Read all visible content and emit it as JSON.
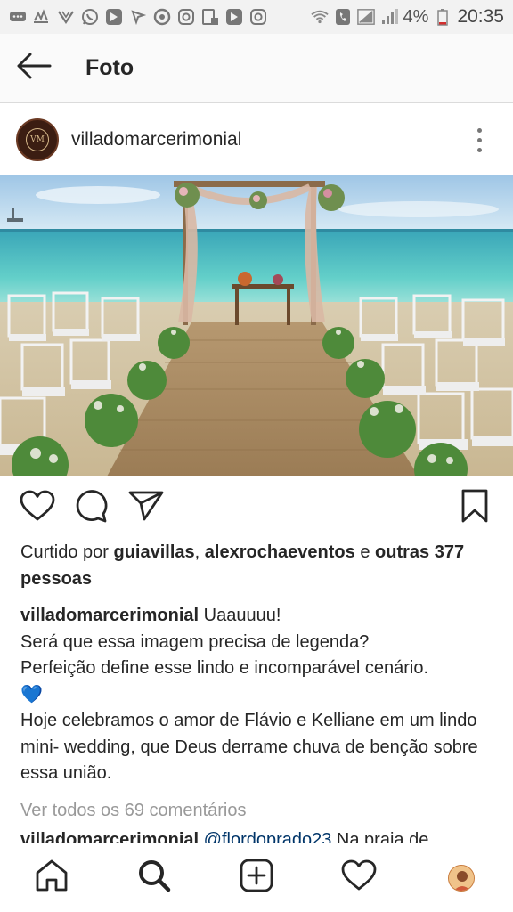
{
  "status_bar": {
    "battery": "4%",
    "time": "20:35",
    "icons": [
      "chat-icon",
      "sms-icon",
      "wifi-call-icon",
      "vpn-icon",
      "whatsapp-icon",
      "app-icon",
      "kite-icon",
      "chrome-icon",
      "instagram-icon",
      "upload-icon",
      "app-icon-2",
      "instagram-icon-2",
      "wifi-icon",
      "phone-icon",
      "no-signal-icon",
      "signal-icon",
      "battery-icon"
    ]
  },
  "app_bar": {
    "title": "Foto"
  },
  "post": {
    "username": "villadomarcerimonial",
    "avatar_text": "VM",
    "likes_prefix": "Curtido por ",
    "liked_by_1": "guiavillas",
    "liked_by_sep": ", ",
    "liked_by_2": "alexrochaeventos",
    "likes_and": " e ",
    "likes_others": "outras 377 pessoas",
    "caption_user": "villadomarcerimonial",
    "caption_line1": " Uaauuuu!",
    "caption_line2": "Será que essa imagem precisa de legenda?",
    "caption_line3": "Perfeição define esse lindo e incomparável cenário.",
    "caption_emoji": "💙",
    "caption_line4": "Hoje celebramos o amor de Flávio e Kelliane em um lindo mini- wedding, que Deus derrame chuva de benção sobre essa união.",
    "view_comments": "Ver todos os 69 comentários",
    "comment_user": "villadomarcerimonial",
    "comment_mention": "@flordoprado23",
    "comment_text": " Na praia de"
  },
  "colors": {
    "accent_text": "#262626",
    "muted": "#999999",
    "mention": "#003569",
    "heart_blue": "#3897f0"
  },
  "icons": {
    "back": "arrow-left-icon",
    "more": "more-vertical-icon",
    "like": "heart-icon",
    "comment": "comment-icon",
    "share": "send-icon",
    "save": "bookmark-icon",
    "home": "home-icon",
    "search": "search-icon",
    "add": "add-post-icon",
    "activity": "heart-icon",
    "profile": "profile-avatar"
  }
}
